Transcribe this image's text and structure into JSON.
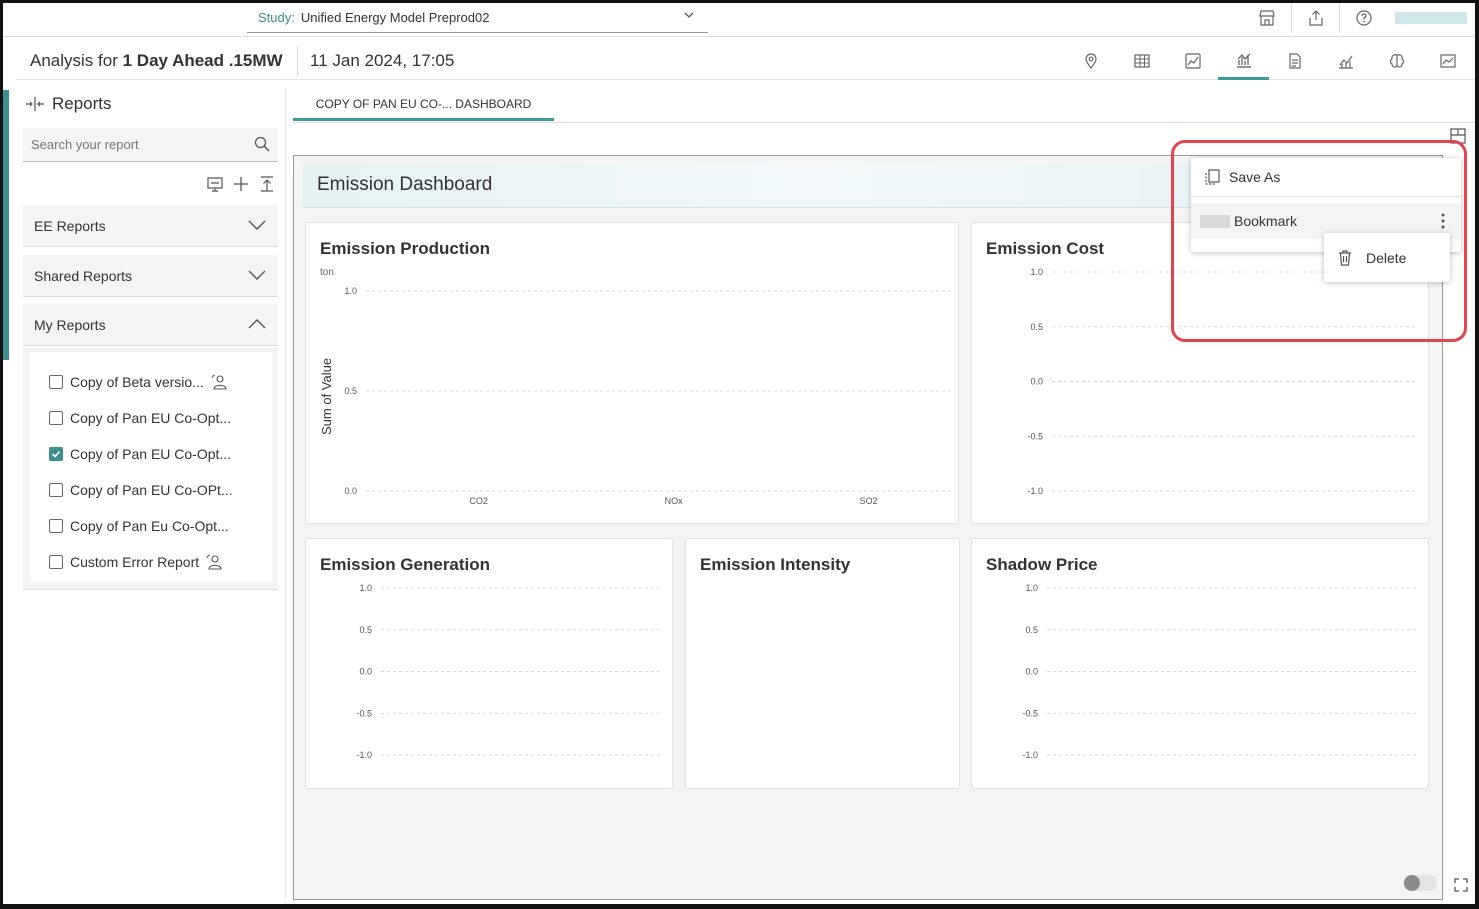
{
  "topbar": {
    "study_label": "Study:",
    "study_value": "Unified Energy Model Preprod02",
    "icons": [
      "store-icon",
      "share-icon",
      "help-icon"
    ]
  },
  "header": {
    "analysis_prefix": "Analysis for",
    "analysis_name": "1 Day Ahead .15MW",
    "date": "11 Jan 2024, 17:05",
    "view_icons": [
      "map-pin-icon",
      "table-icon",
      "chart-edit-icon",
      "report-dashboard-icon",
      "document-icon",
      "line-chart-icon",
      "brain-icon",
      "image-chart-icon"
    ],
    "active_view": "report-dashboard-icon"
  },
  "sidebar": {
    "title": "Reports",
    "search_placeholder": "Search your report",
    "sections": [
      {
        "label": "EE Reports",
        "expanded": false
      },
      {
        "label": "Shared Reports",
        "expanded": false
      },
      {
        "label": "My Reports",
        "expanded": true
      }
    ],
    "my_reports": [
      {
        "label": "Copy of Beta versio...",
        "checked": false,
        "shared": true
      },
      {
        "label": "Copy of Pan EU Co-Opt...",
        "checked": false,
        "shared": false
      },
      {
        "label": "Copy of Pan EU Co-Opt...",
        "checked": true,
        "shared": false
      },
      {
        "label": "Copy of Pan EU Co-OPt...",
        "checked": false,
        "shared": false
      },
      {
        "label": "Copy of Pan Eu Co-Opt...",
        "checked": false,
        "shared": false
      },
      {
        "label": "Custom Error Report",
        "checked": false,
        "shared": true
      }
    ]
  },
  "tab": {
    "label": "COPY OF PAN EU CO-... DASHBOARD"
  },
  "dashboard": {
    "title": "Emission Dashboard"
  },
  "cards": {
    "production": {
      "title": "Emission Production"
    },
    "cost": {
      "title": "Emission Cost"
    },
    "generation": {
      "title": "Emission Generation"
    },
    "intensity": {
      "title": "Emission Intensity"
    },
    "shadow": {
      "title": "Shadow Price"
    }
  },
  "popup": {
    "save_as": "Save As",
    "bookmark": "Bookmark",
    "delete": "Delete"
  },
  "colors": {
    "accent": "#3d8f8f",
    "highlight": "#e2464c"
  },
  "chart_data": [
    {
      "type": "bar",
      "title": "Emission Production",
      "unit": "ton",
      "ylabel": "Sum of Value",
      "categories": [
        "CO2",
        "NOx",
        "SO2"
      ],
      "values": [],
      "ylim": [
        0,
        1
      ],
      "yticks": [
        "1.0",
        "0.5",
        "0.0"
      ],
      "grid": true
    },
    {
      "type": "line",
      "title": "Emission Cost",
      "values": [],
      "ylim": [
        -1,
        1
      ],
      "yticks": [
        "1.0",
        "0.5",
        "0.0",
        "-0.5",
        "-1.0"
      ],
      "grid": true
    },
    {
      "type": "line",
      "title": "Emission Generation",
      "values": [],
      "ylim": [
        -1,
        1
      ],
      "yticks": [
        "1.0",
        "0.5",
        "0.0",
        "-0.5",
        "-1.0"
      ],
      "grid": true
    },
    {
      "type": "line",
      "title": "Shadow Price",
      "values": [],
      "ylim": [
        -1,
        1
      ],
      "yticks": [
        "1.0",
        "0.5",
        "0.0",
        "-0.5",
        "-1.0"
      ],
      "grid": true
    }
  ]
}
